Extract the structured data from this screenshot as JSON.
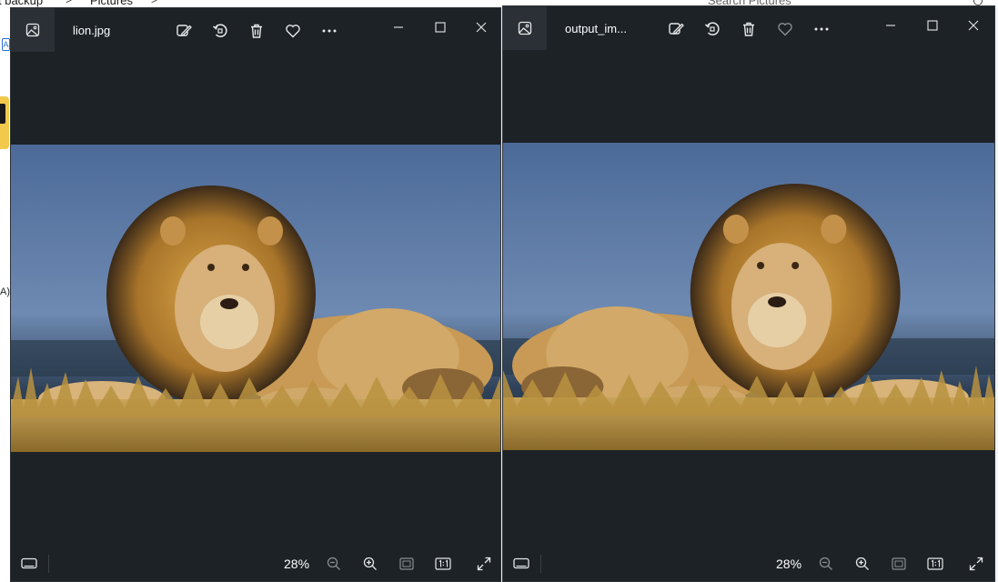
{
  "background": {
    "breadcrumb": [
      "t backup",
      "Pictures"
    ],
    "breadcrumb_separator": ">",
    "search_placeholder": "Search Pictures",
    "chip_letter": "A",
    "left_fragment": "A)"
  },
  "windows": [
    {
      "title": "lion.jpg",
      "mirrored": false,
      "favorite_dimmed": false,
      "zoom": "28%"
    },
    {
      "title": "output_im...",
      "mirrored": true,
      "favorite_dimmed": true,
      "zoom": "28%"
    }
  ],
  "icons": {
    "app": "photos-app-icon",
    "edit": "edit-image-icon",
    "rotate": "rotate-icon",
    "delete": "delete-icon",
    "favorite": "heart-icon",
    "more": "more-icon",
    "minimize": "minimize-icon",
    "maximize": "maximize-icon",
    "close": "close-icon",
    "filmstrip": "filmstrip-icon",
    "zoom_out": "zoom-out-icon",
    "zoom_in": "zoom-in-icon",
    "fit": "fit-to-window-icon",
    "actual_size": "actual-size-icon",
    "fullscreen": "fullscreen-icon"
  },
  "colors": {
    "window_bg": "#1c2226",
    "icon": "#e8e8e8",
    "icon_dim": "#8a8f93",
    "sky": "#5b78a6",
    "grass": "#b08a3c"
  }
}
